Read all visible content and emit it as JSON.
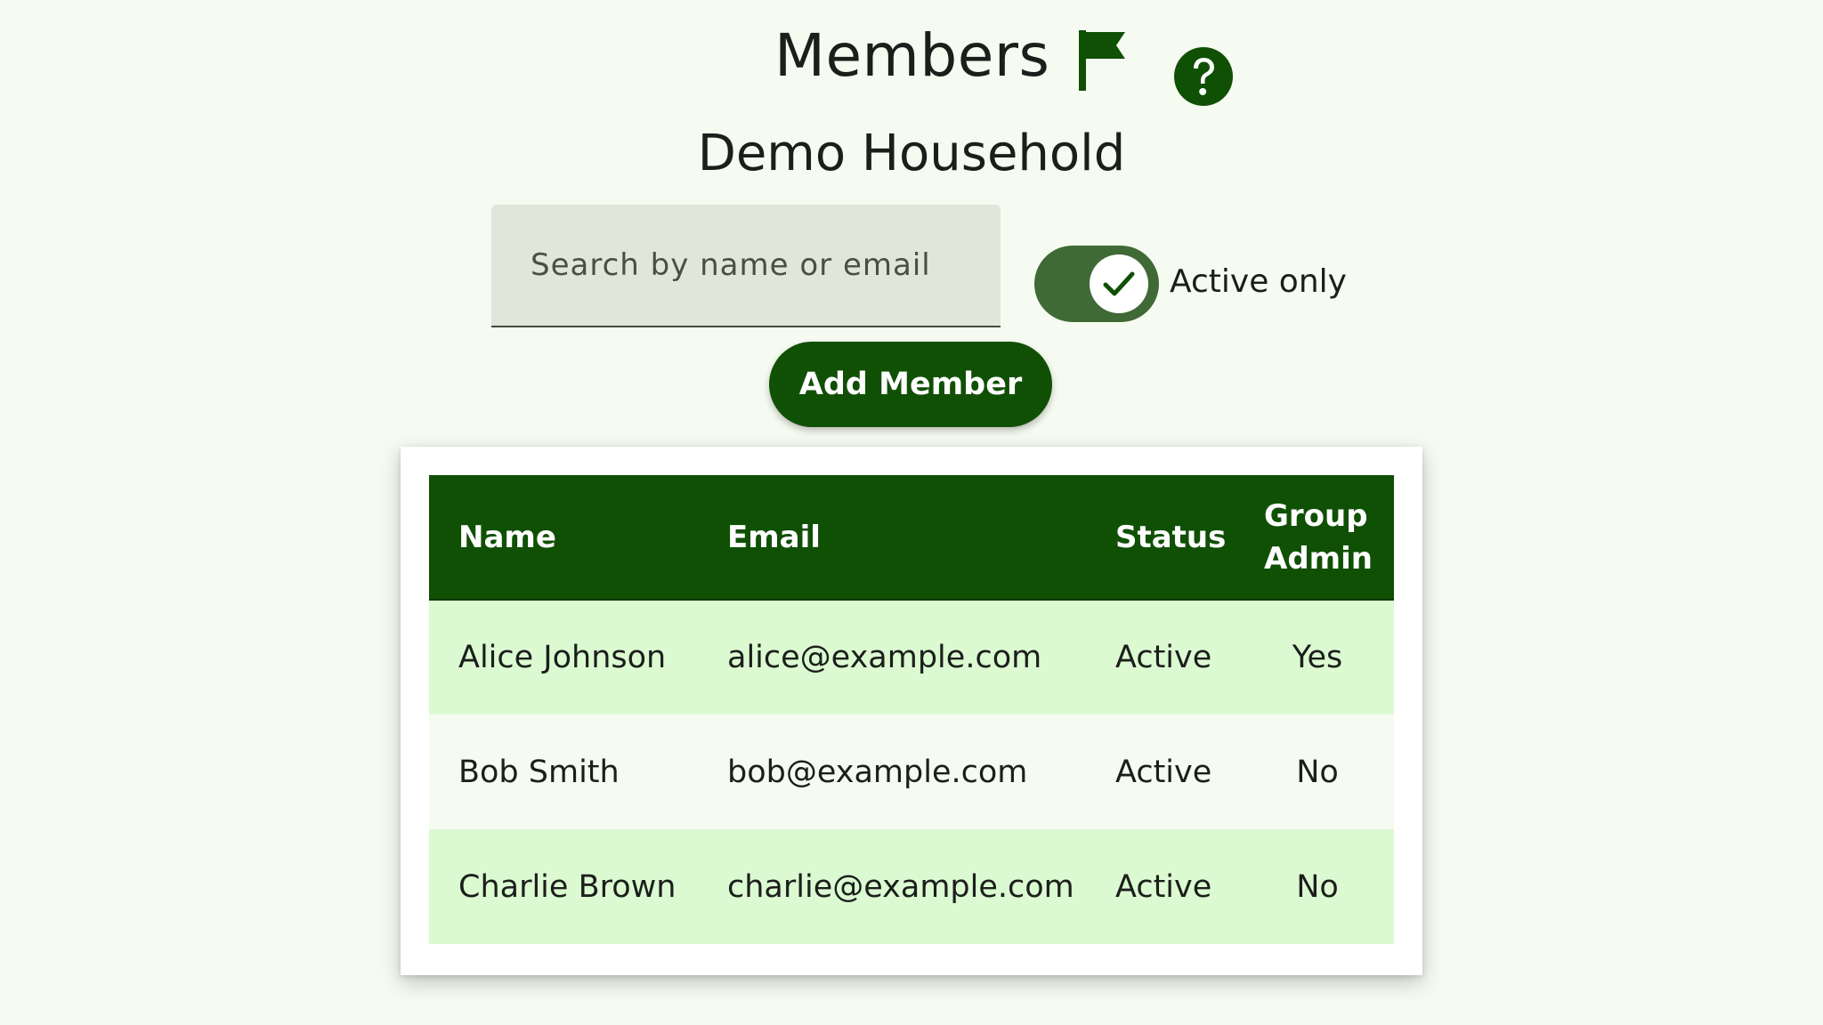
{
  "header": {
    "title": "Members",
    "household": "Demo Household"
  },
  "icons": {
    "flag": "flag-icon",
    "help": "help-circle-icon",
    "check": "check-icon"
  },
  "search": {
    "placeholder": "Search by name or email",
    "value": ""
  },
  "filter": {
    "toggle_label": "Active only",
    "checked": true
  },
  "actions": {
    "add_label": "Add Member"
  },
  "table": {
    "columns": [
      "Name",
      "Email",
      "Status",
      "Group Admin"
    ],
    "rows": [
      {
        "name": "Alice Johnson",
        "email": "alice@example.com",
        "status": "Active",
        "admin": "Yes"
      },
      {
        "name": "Bob Smith",
        "email": "bob@example.com",
        "status": "Active",
        "admin": "No"
      },
      {
        "name": "Charlie Brown",
        "email": "charlie@example.com",
        "status": "Active",
        "admin": "No"
      }
    ]
  },
  "colors": {
    "primary": "#105005",
    "background": "#f6fbf1",
    "row_highlight": "#dcfad2",
    "toggle_track": "#3f6a35",
    "search_fill": "#e2e6da"
  }
}
